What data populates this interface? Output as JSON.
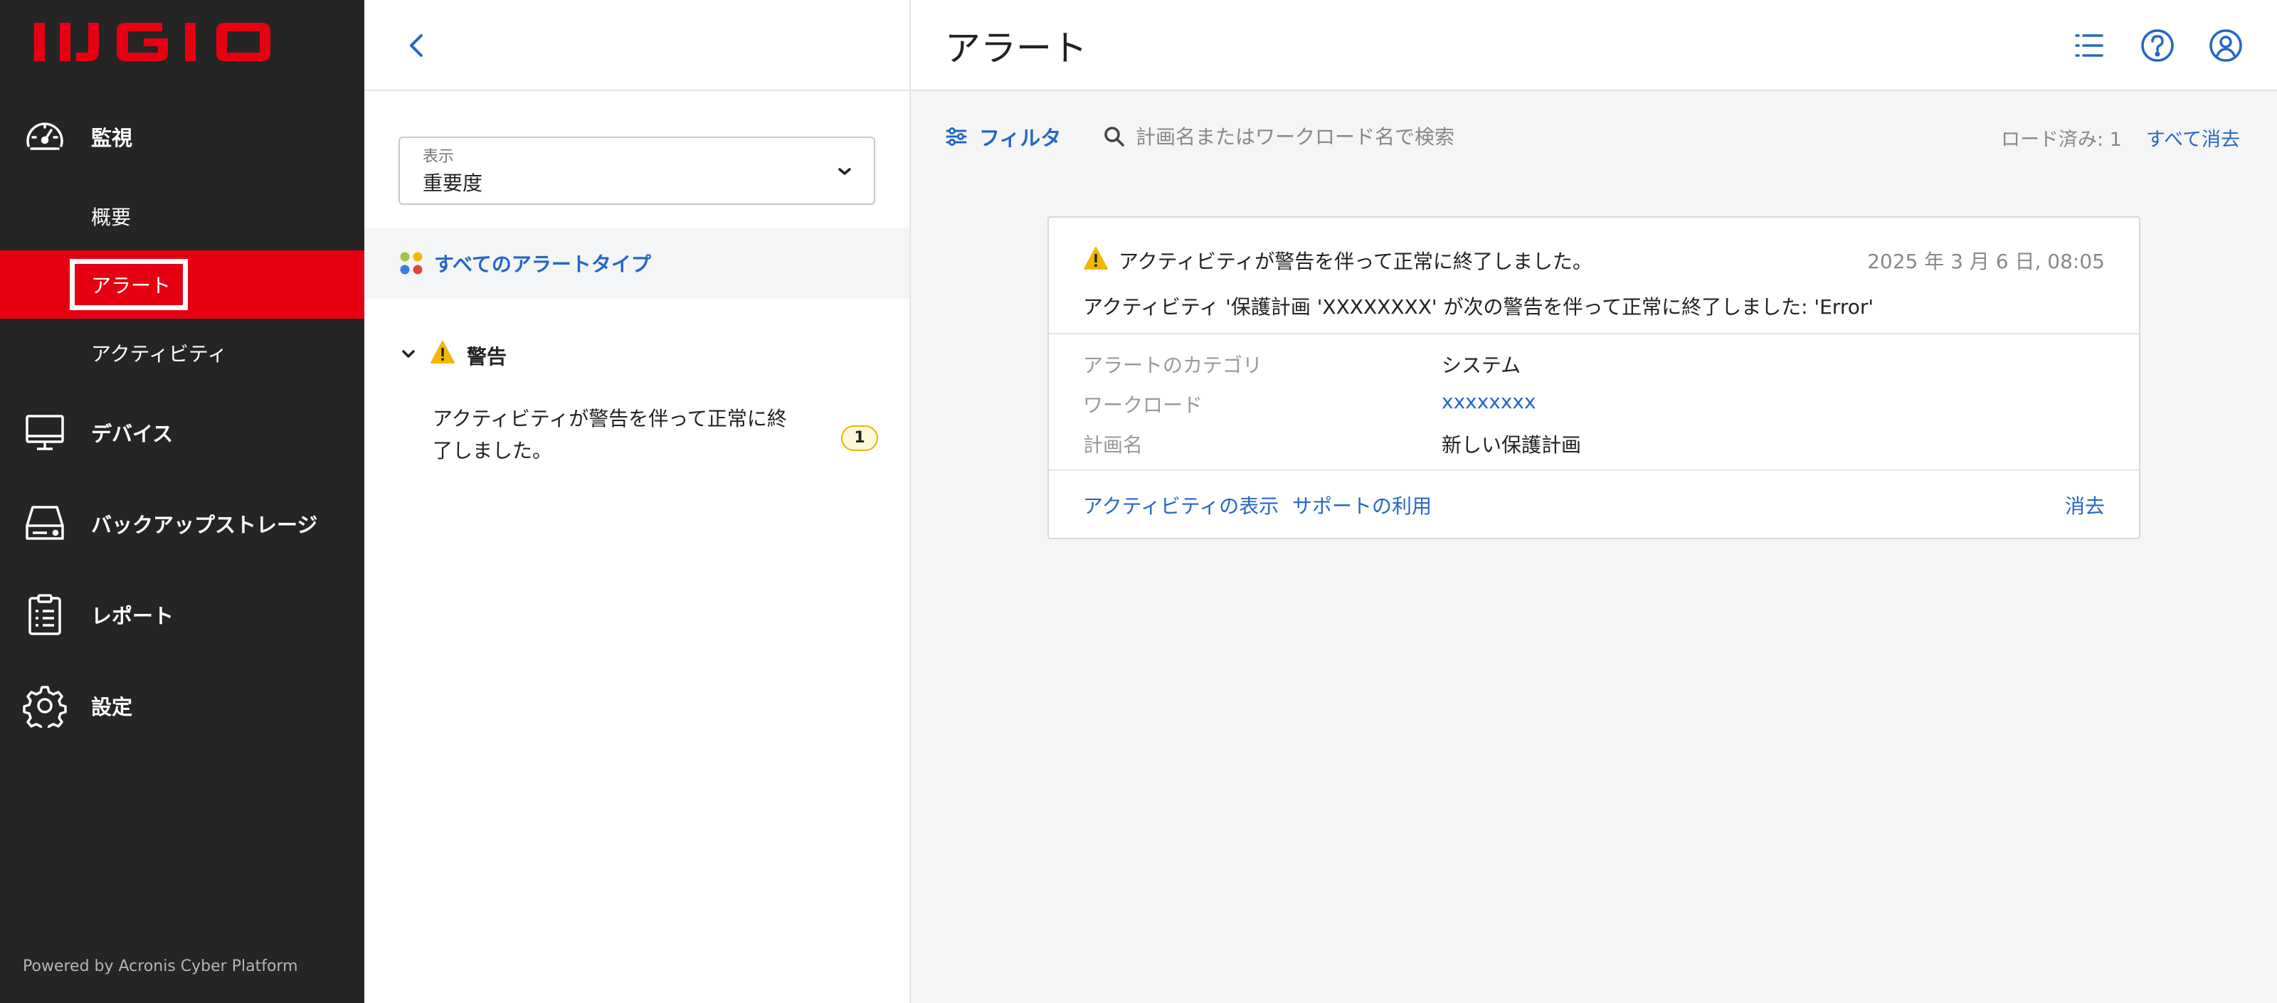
{
  "brand": {
    "logo_text": "IIJ GIO",
    "logo_color": "#e60012"
  },
  "sidebar": {
    "monitoring": {
      "label": "監視",
      "icon": "gauge-icon"
    },
    "sub_items": [
      {
        "label": "概要"
      },
      {
        "label": "アラート",
        "active": true
      },
      {
        "label": "アクティビティ"
      }
    ],
    "items": [
      {
        "label": "デバイス",
        "icon": "monitor-icon"
      },
      {
        "label": "バックアップストレージ",
        "icon": "drive-icon"
      },
      {
        "label": "レポート",
        "icon": "clipboard-icon"
      },
      {
        "label": "設定",
        "icon": "gear-icon"
      }
    ],
    "powered_by": "Powered by Acronis Cyber Platform"
  },
  "middle": {
    "view_select": {
      "caption": "表示",
      "value": "重要度"
    },
    "all_types": "すべてのアラートタイプ",
    "group": {
      "label": "警告"
    },
    "alert_type": {
      "label": "アクティビティが警告を伴って正常に終了しました。",
      "count": "1"
    }
  },
  "header": {
    "title": "アラート"
  },
  "toolbar": {
    "filter": "フィルタ",
    "search_placeholder": "計画名またはワークロード名で検索",
    "loaded": "ロード済み: 1",
    "clear_all": "すべて消去"
  },
  "alert": {
    "title": "アクティビティが警告を伴って正常に終了しました。",
    "date": "2025 年 3 月 6 日, 08:05",
    "description": "アクティビティ '保護計画 'XXXXXXXX' が次の警告を伴って正常に終了しました: 'Error'",
    "fields": [
      {
        "key": "アラートのカテゴリ",
        "value": "システム"
      },
      {
        "key": "ワークロード",
        "value": "xxxxxxxx"
      },
      {
        "key": "計画名",
        "value": "新しい保護計画"
      }
    ],
    "actions": {
      "view_activity": "アクティビティの表示",
      "get_support": "サポートの利用",
      "dismiss": "消去"
    }
  },
  "colors": {
    "accent": "#2567c4",
    "sidebar_bg": "#252525",
    "warning": "#f2b700"
  }
}
